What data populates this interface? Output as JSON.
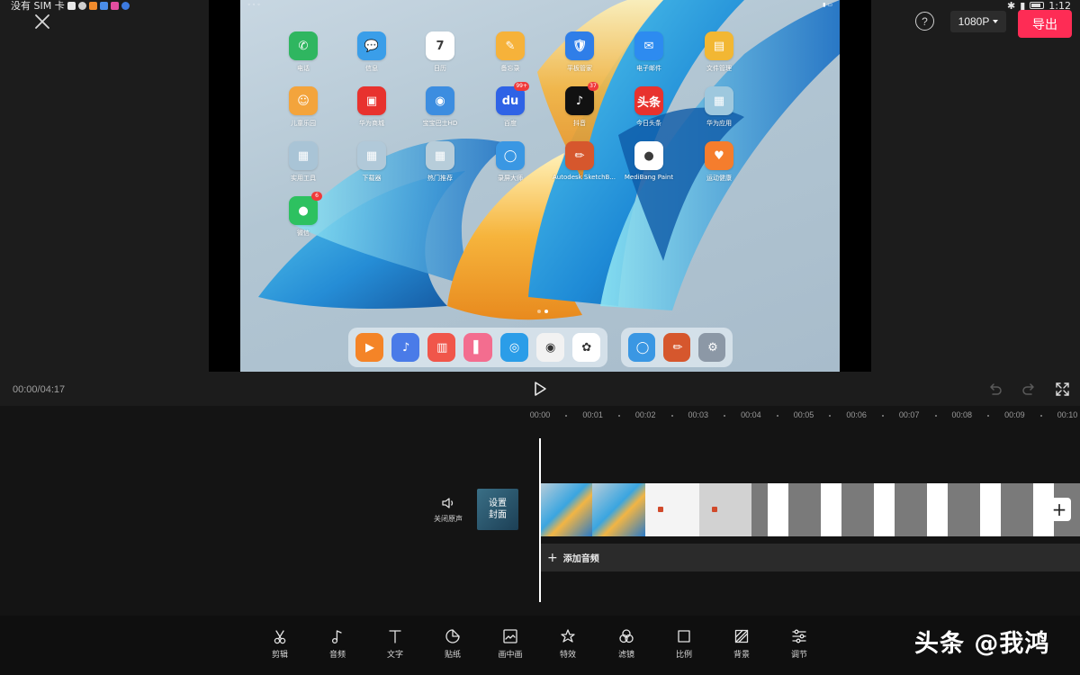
{
  "status_bar": {
    "left_text": "没有 SIM 卡",
    "time": "1:12"
  },
  "header": {
    "close_icon": "close-icon",
    "help_label": "?",
    "resolution": "1080P",
    "export_label": "导出"
  },
  "preview": {
    "tablet_apps": [
      {
        "label": "电话",
        "color": "#2fb660",
        "glyph": "✆"
      },
      {
        "label": "信息",
        "color": "#3a9ee9",
        "glyph": "💬"
      },
      {
        "label": "日历",
        "color": "#ffffff",
        "glyph": "7",
        "dark_glyph": true
      },
      {
        "label": "备忘录",
        "color": "#f6b23a",
        "glyph": "✎"
      },
      {
        "label": "平板管家",
        "color": "#2f7ee8",
        "glyph": "🛡"
      },
      {
        "label": "电子邮件",
        "color": "#2d8bf0",
        "glyph": "✉"
      },
      {
        "label": "文件管理",
        "color": "#f2b733",
        "glyph": "▤"
      },
      {
        "label": "儿童乐园",
        "color": "#f3a43c",
        "glyph": "☺"
      },
      {
        "label": "华为商城",
        "color": "#e8322e",
        "glyph": "▣"
      },
      {
        "label": "宝宝巴士HD",
        "color": "#3c8de0",
        "glyph": "◉"
      },
      {
        "label": "百度",
        "color": "#2f63e6",
        "glyph": "du",
        "badge": "99+"
      },
      {
        "label": "抖音",
        "color": "#111111",
        "glyph": "♪",
        "badge": "37"
      },
      {
        "label": "今日头条",
        "color": "#e8322e",
        "glyph": "头条"
      },
      {
        "label": "华为应用",
        "color": "#9ec8de",
        "glyph": "▦"
      },
      {
        "label": "实用工具",
        "color": "#a9c4d6",
        "glyph": "▦"
      },
      {
        "label": "下载器",
        "color": "#b1c9d9",
        "glyph": "▦"
      },
      {
        "label": "热门推荐",
        "color": "#b7cdda",
        "glyph": "▦"
      },
      {
        "label": "录屏大师",
        "color": "#3a97e3",
        "glyph": "◯"
      },
      {
        "label": "Autodesk SketchB...",
        "color": "#d6572d",
        "glyph": "✏"
      },
      {
        "label": "MediBang Paint",
        "color": "#ffffff",
        "glyph": "●",
        "dark_glyph": true
      },
      {
        "label": "运动健康",
        "color": "#f57d2d",
        "glyph": "♥"
      },
      {
        "label": "微信",
        "color": "#2dc160",
        "glyph": "●",
        "badge": "6"
      }
    ],
    "dock_left": [
      {
        "name": "video-app",
        "color": "#f48427",
        "glyph": "▶"
      },
      {
        "name": "music-app",
        "color": "#4a7be8",
        "glyph": "♪"
      },
      {
        "name": "books-app",
        "color": "#f0564a",
        "glyph": "▥"
      },
      {
        "name": "theme-app",
        "color": "#f36d8f",
        "glyph": "▌"
      },
      {
        "name": "browser-app",
        "color": "#2b9de8",
        "glyph": "◎"
      },
      {
        "name": "camera-app",
        "color": "#f2f2f2",
        "glyph": "◉",
        "dark_glyph": true
      },
      {
        "name": "gallery-app",
        "color": "#ffffff",
        "glyph": "✿",
        "dark_glyph": true
      }
    ],
    "dock_right": [
      {
        "name": "screen-recorder-app",
        "color": "#3a97e3",
        "glyph": "◯"
      },
      {
        "name": "sketchbook-app",
        "color": "#d6572d",
        "glyph": "✏"
      },
      {
        "name": "settings-app",
        "color": "#8c98a6",
        "glyph": "⚙"
      }
    ]
  },
  "playback": {
    "timecode": "00:00/04:17"
  },
  "timeline": {
    "ruler_ticks": [
      "00:00",
      "00:01",
      "00:02",
      "00:03",
      "00:04",
      "00:05",
      "00:06",
      "00:07",
      "00:08",
      "00:09",
      "00:10"
    ],
    "mute_label": "关闭原声",
    "cover_label": "设置封面",
    "add_audio_label": "添加音频",
    "add_clip_label": "+"
  },
  "toolbar": {
    "items": [
      {
        "label": "剪辑",
        "icon": "scissors-icon"
      },
      {
        "label": "音频",
        "icon": "music-note-icon"
      },
      {
        "label": "文字",
        "icon": "text-icon"
      },
      {
        "label": "贴纸",
        "icon": "sticker-icon"
      },
      {
        "label": "画中画",
        "icon": "picture-in-picture-icon"
      },
      {
        "label": "特效",
        "icon": "effects-star-icon"
      },
      {
        "label": "滤镜",
        "icon": "filter-icon"
      },
      {
        "label": "比例",
        "icon": "ratio-icon"
      },
      {
        "label": "背景",
        "icon": "background-icon"
      },
      {
        "label": "调节",
        "icon": "adjust-sliders-icon"
      }
    ]
  },
  "watermark": "头条 @我鸿",
  "colors": {
    "export": "#fe2c55",
    "background": "#1c1c1c",
    "timeline": "#141414",
    "toolbar": "#0f0f0f"
  }
}
